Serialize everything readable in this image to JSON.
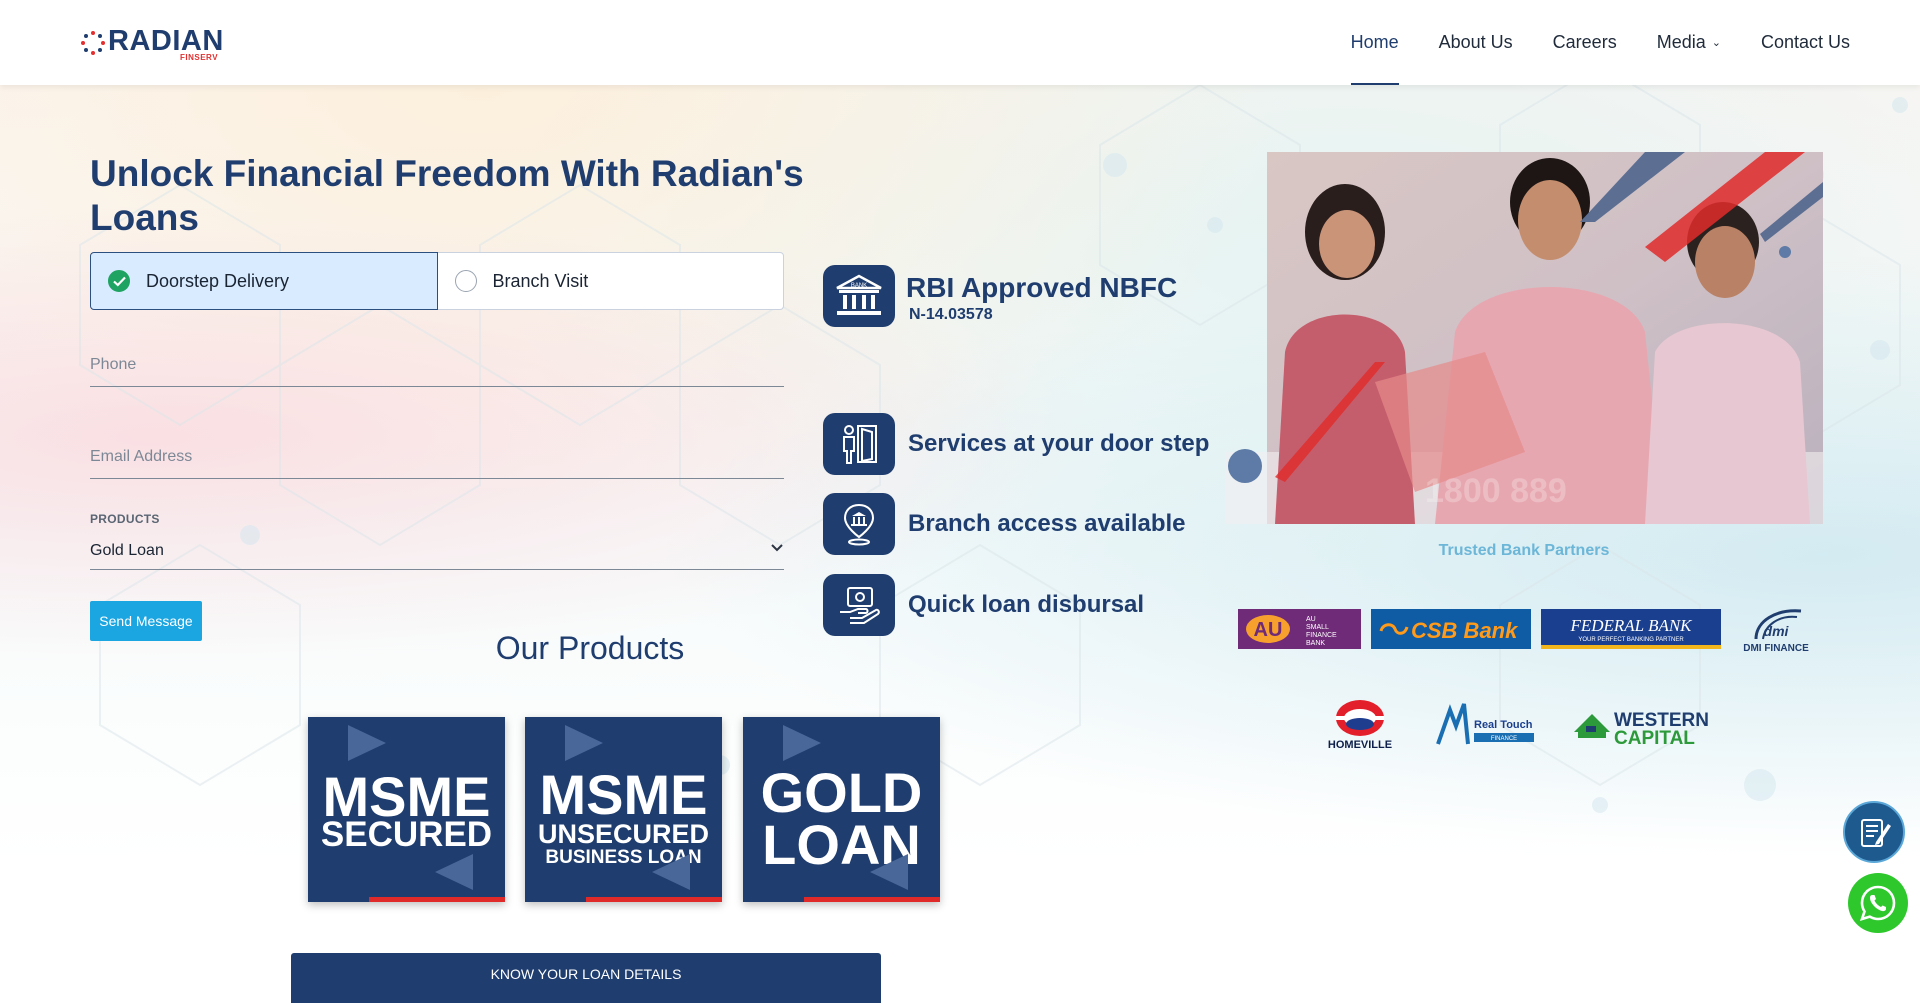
{
  "brand": {
    "name": "RADIAN",
    "sub": "FINSERV",
    "colors": {
      "primary": "#1f3d6e",
      "accent": "#1ba5e1",
      "red": "#e02a2a",
      "success": "#1fa362"
    }
  },
  "nav": {
    "items": [
      {
        "label": "Home",
        "active": true
      },
      {
        "label": "About Us"
      },
      {
        "label": "Careers"
      },
      {
        "label": "Media",
        "has_dropdown": true
      },
      {
        "label": "Contact Us"
      }
    ]
  },
  "hero": {
    "title": "Unlock Financial Freedom With Radian's Loans",
    "visit_options": [
      {
        "label": "Doorstep Delivery",
        "selected": true
      },
      {
        "label": "Branch Visit",
        "selected": false
      }
    ],
    "form": {
      "phone_placeholder": "Phone",
      "email_placeholder": "Email Address",
      "products_label": "PRODUCTS",
      "product_selected": "Gold Loan",
      "submit_label": "Send Message"
    }
  },
  "features": {
    "rbi_title": "RBI Approved NBFC",
    "rbi_number": "N-14.03578",
    "rbi_icon_text": "BANK",
    "items": [
      {
        "label": "Services at your door step",
        "icon": "door-person-icon"
      },
      {
        "label": "Branch access available",
        "icon": "location-bank-icon"
      },
      {
        "label": "Quick loan disbursal",
        "icon": "hand-money-icon"
      }
    ]
  },
  "partners": {
    "title": "Trusted Bank Partners",
    "logos": [
      {
        "name": "AU",
        "sub": [
          "AU",
          "SMALL",
          "FINANCE",
          "BANK"
        ],
        "bg": "#6f2a78",
        "fg": "#f7a02e"
      },
      {
        "name": "CSB Bank",
        "bg": "#0f5ba4",
        "fg": "#ff9a1a"
      },
      {
        "name": "FEDERAL BANK",
        "tagline": "YOUR PERFECT BANKING PARTNER",
        "bg": "#1a3f8f",
        "fg": "#ffffff"
      },
      {
        "name": "DMI FINANCE",
        "fg": "#1f3d6e"
      },
      {
        "name": "HOMEVILLE",
        "fg": "#0d1f4a"
      },
      {
        "name": "Real Touch",
        "sub": "FINANCE",
        "fg": "#1a6fb3"
      },
      {
        "name": "WESTERN",
        "name2": "CAPITAL",
        "fg": "#1f3d6e",
        "accent": "#2c9a3a"
      }
    ]
  },
  "products": {
    "title": "Our Products",
    "cards": [
      {
        "line1": "MSME",
        "line2": "SECURED",
        "line3": ""
      },
      {
        "line1": "MSME",
        "line2": "UNSECURED",
        "line3": "BUSINESS LOAN"
      },
      {
        "line1": "GOLD",
        "line2": "LOAN",
        "line3": ""
      }
    ],
    "cta": "KNOW YOUR LOAN DETAILS"
  },
  "floating": {
    "form_icon": "form-edit-icon",
    "whatsapp_icon": "whatsapp-icon"
  }
}
